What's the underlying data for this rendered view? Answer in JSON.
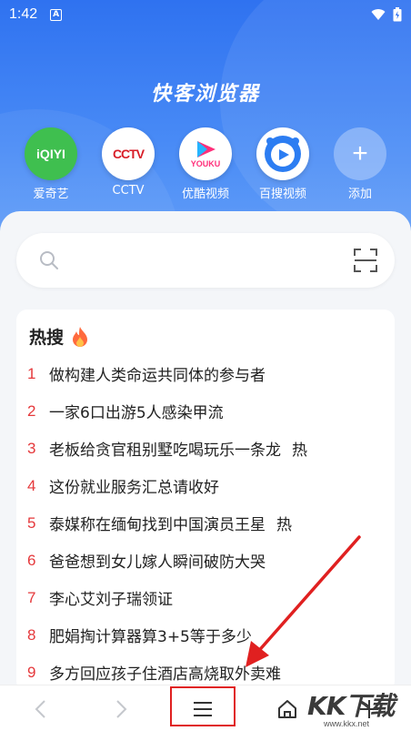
{
  "status_bar": {
    "time": "1:42",
    "notification_badge": "A"
  },
  "app": {
    "title": "快客浏览器"
  },
  "shortcuts": [
    {
      "label": "爱奇艺",
      "icon_text": "iQIYI",
      "icon": "iqiyi-icon"
    },
    {
      "label": "CCTV",
      "icon_text": "CCTV",
      "icon": "cctv-icon"
    },
    {
      "label": "优酷视频",
      "icon_text": "YOUKU",
      "icon": "youku-icon"
    },
    {
      "label": "百搜视频",
      "icon_text": "",
      "icon": "play-icon"
    },
    {
      "label": "添加",
      "icon_text": "+",
      "icon": "add-icon"
    }
  ],
  "search": {
    "placeholder": ""
  },
  "hot": {
    "title": "热搜",
    "items": [
      {
        "rank": "1",
        "text": "做构建人类命运共同体的参与者",
        "tag": ""
      },
      {
        "rank": "2",
        "text": "一家6口出游5人感染甲流",
        "tag": ""
      },
      {
        "rank": "3",
        "text": "老板给贪官租别墅吃喝玩乐一条龙",
        "tag": "热"
      },
      {
        "rank": "4",
        "text": "这份就业服务汇总请收好",
        "tag": ""
      },
      {
        "rank": "5",
        "text": "泰媒称在缅甸找到中国演员王星",
        "tag": "热"
      },
      {
        "rank": "6",
        "text": "爸爸想到女儿嫁人瞬间破防大哭",
        "tag": ""
      },
      {
        "rank": "7",
        "text": "李心艾刘子瑞领证",
        "tag": ""
      },
      {
        "rank": "8",
        "text": "肥娟掏计算器算3+5等于多少",
        "tag": ""
      },
      {
        "rank": "9",
        "text": "多方回应孩子住酒店高烧取外卖难",
        "tag": ""
      }
    ]
  },
  "watermark": {
    "logo": "KK下载",
    "url": "www.kkx.net"
  },
  "colors": {
    "accent_blue": "#2f72f0",
    "rank_red": "#e5383b",
    "highlight_red": "#e02020"
  }
}
